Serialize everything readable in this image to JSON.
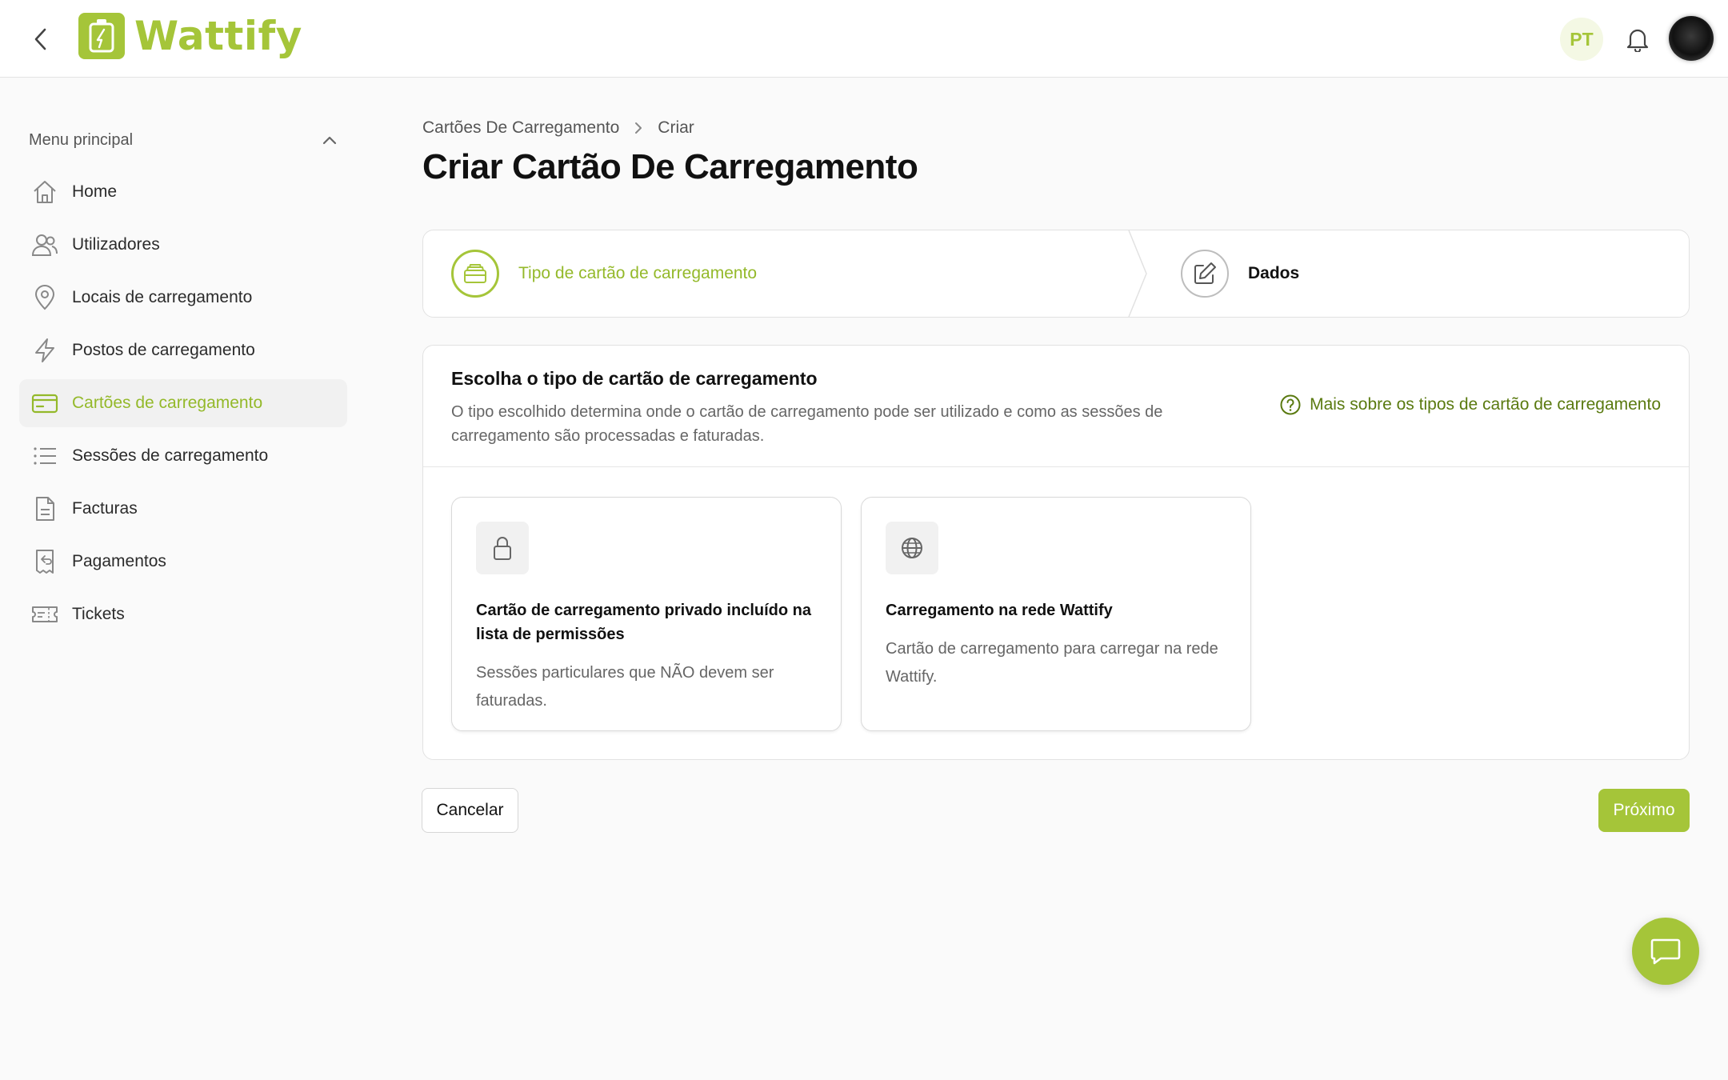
{
  "header": {
    "brand": "Wattify",
    "language": "PT"
  },
  "sidebar": {
    "section_label": "Menu principal",
    "items": [
      {
        "label": "Home",
        "icon": "home-icon"
      },
      {
        "label": "Utilizadores",
        "icon": "users-icon"
      },
      {
        "label": "Locais de carregamento",
        "icon": "map-pin-icon"
      },
      {
        "label": "Postos de carregamento",
        "icon": "lightning-icon"
      },
      {
        "label": "Cartões de carregamento",
        "icon": "credit-card-icon",
        "active": true
      },
      {
        "label": "Sessões de carregamento",
        "icon": "list-icon"
      },
      {
        "label": "Facturas",
        "icon": "document-icon"
      },
      {
        "label": "Pagamentos",
        "icon": "receipt-icon"
      },
      {
        "label": "Tickets",
        "icon": "ticket-icon"
      }
    ]
  },
  "breadcrumb": {
    "parent": "Cartões De Carregamento",
    "current": "Criar"
  },
  "page": {
    "title": "Criar Cartão De Carregamento"
  },
  "stepper": {
    "steps": [
      {
        "label": "Tipo de cartão de carregamento",
        "icon": "card-stack-icon",
        "state": "active"
      },
      {
        "label": "Dados",
        "icon": "edit-icon",
        "state": "pending"
      }
    ]
  },
  "panel": {
    "title": "Escolha o tipo de cartão de carregamento",
    "description": "O tipo escolhido determina onde o cartão de carregamento pode ser utilizado e como as sessões de carregamento são processadas e faturadas.",
    "help_link": "Mais sobre os tipos de cartão de carregamento",
    "options": [
      {
        "icon": "lock-icon",
        "title": "Cartão de carregamento privado incluído na lista de permissões",
        "description": "Sessões particulares que NÃO devem ser faturadas."
      },
      {
        "icon": "globe-icon",
        "title": "Carregamento na rede Wattify",
        "description": "Cartão de carregamento para carregar na rede Wattify."
      }
    ]
  },
  "actions": {
    "cancel": "Cancelar",
    "next": "Próximo"
  },
  "colors": {
    "brand": "#a5c539",
    "brand_text": "#94b92a",
    "link": "#5a7a10"
  }
}
